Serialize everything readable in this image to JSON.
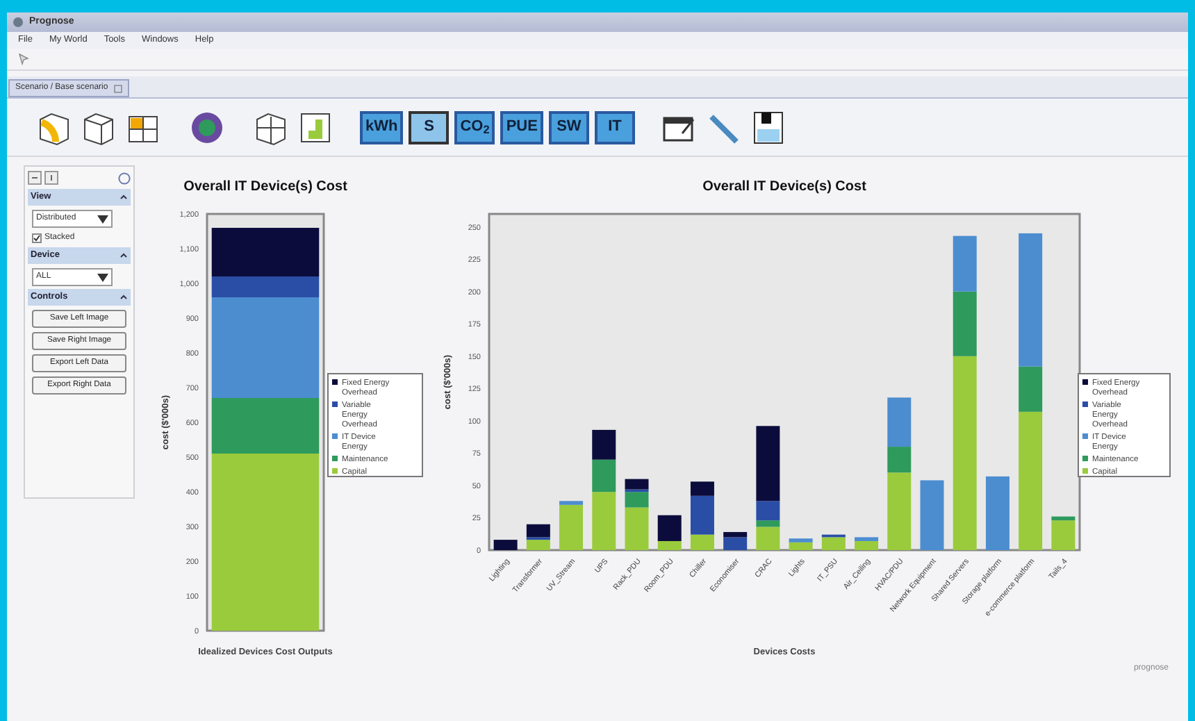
{
  "window": {
    "title": "Prognose"
  },
  "menu": [
    "File",
    "My World",
    "Tools",
    "Windows",
    "Help"
  ],
  "document_tab": {
    "label": "Scenario / Base scenario"
  },
  "metric_buttons": [
    {
      "label": "kWh",
      "selected": false
    },
    {
      "label": "S",
      "selected": true
    },
    {
      "label": "CO$_{2}$",
      "selected": false
    },
    {
      "label": "PUE",
      "selected": false
    },
    {
      "label": "SW",
      "selected": false
    },
    {
      "label": "IT",
      "selected": false
    }
  ],
  "sidebar": {
    "sections": [
      {
        "title": "View",
        "expanded": true,
        "controls": [
          {
            "kind": "dropdown",
            "value": "Distributed"
          },
          {
            "kind": "checkbox",
            "label": "Stacked",
            "checked": true
          }
        ]
      },
      {
        "title": "Device",
        "expanded": true,
        "controls": [
          {
            "kind": "dropdown",
            "value": "ALL"
          }
        ]
      },
      {
        "title": "Controls",
        "expanded": true,
        "controls": [
          {
            "kind": "button",
            "label": "Save Left Image"
          },
          {
            "kind": "button",
            "label": "Save Right Image"
          },
          {
            "kind": "button",
            "label": "Export Left Data"
          },
          {
            "kind": "button",
            "label": "Export Right Data"
          }
        ]
      }
    ]
  },
  "left_chart": {
    "chart_data": {
      "type": "bar",
      "stacked": true,
      "title": "Overall IT Device(s) Cost",
      "xlabel": "Idealized Devices Cost Outputs",
      "ylabel": "cost ($'000s)",
      "categories": [
        null
      ],
      "legend": "right",
      "ylim": [
        0,
        1200
      ],
      "yticks": [
        0,
        100,
        200,
        300,
        400,
        500,
        600,
        700,
        800,
        900,
        {
          "value": 1000,
          "label": "1,000"
        },
        {
          "value": 1100,
          "label": "1,100"
        },
        {
          "value": 1200,
          "label": "1,200"
        }
      ],
      "series": [
        {
          "name": "Capital",
          "color": "#9acb3c",
          "values": [
            510
          ]
        },
        {
          "name": "Maintenance",
          "color": "#2e9a5c",
          "values": [
            160
          ]
        },
        {
          "name": "IT Device Energy",
          "color": "#4c8dd0",
          "values": [
            290
          ]
        },
        {
          "name": "Variable Energy Overhead",
          "color": "#2a4ea6",
          "values": [
            60
          ]
        },
        {
          "name": "Fixed Energy Overhead",
          "color": "#0c0c3c",
          "values": [
            140
          ]
        }
      ]
    }
  },
  "right_chart": {
    "chart_data": {
      "type": "bar",
      "stacked": true,
      "title": "Overall IT Device(s) Cost",
      "xlabel": "Devices Costs",
      "ylabel": "cost ($'000s)",
      "categories": [
        "Lighting",
        "Transformer",
        "UV_Stream",
        "UPS",
        "Rack_PDU",
        "Room_PDU",
        "Chiller",
        "Economiser",
        "CRAC",
        "Lights",
        "IT_PSU",
        "Air_Ceiling",
        "HVAC/PDU",
        "Network Equipment",
        "Shared Servers",
        "Storage platform",
        "e-commerce platform",
        "Tails_4"
      ],
      "legend": "right",
      "ylim": [
        0,
        260
      ],
      "yticks": [
        0,
        25,
        50,
        75,
        100,
        125,
        150,
        175,
        200,
        225,
        250
      ],
      "series": [
        {
          "name": "Capital",
          "color": "#9acb3c",
          "values": [
            0,
            8,
            35,
            45,
            33,
            7,
            12,
            0,
            18,
            6,
            10,
            7,
            60,
            0,
            150,
            0,
            107,
            23
          ]
        },
        {
          "name": "Maintenance",
          "color": "#2e9a5c",
          "values": [
            0,
            0,
            0,
            25,
            12,
            0,
            0,
            0,
            5,
            0,
            0,
            0,
            20,
            0,
            50,
            0,
            35,
            3
          ]
        },
        {
          "name": "IT Device Energy",
          "color": "#4c8dd0",
          "values": [
            0,
            0,
            3,
            0,
            0,
            0,
            0,
            0,
            0,
            3,
            0,
            3,
            38,
            54,
            43,
            57,
            103,
            0
          ]
        },
        {
          "name": "Variable Energy Overhead",
          "color": "#2a4ea6",
          "values": [
            0,
            2,
            0,
            0,
            2,
            0,
            30,
            10,
            15,
            0,
            2,
            0,
            0,
            0,
            0,
            0,
            0,
            0
          ]
        },
        {
          "name": "Fixed Energy Overhead",
          "color": "#0c0c3c",
          "values": [
            8,
            10,
            0,
            23,
            8,
            20,
            11,
            4,
            58,
            0,
            0,
            0,
            0,
            0,
            0,
            0,
            0,
            0
          ]
        }
      ]
    }
  },
  "logo_text": "prognose"
}
